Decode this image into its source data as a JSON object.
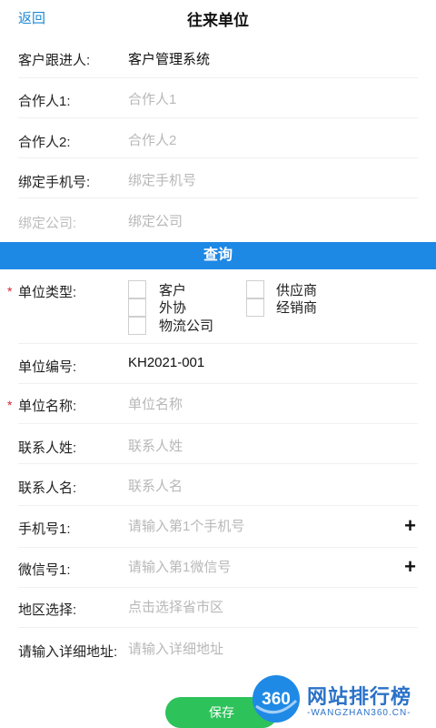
{
  "header": {
    "back_label": "返回",
    "title": "往来单位"
  },
  "top_form": {
    "follower": {
      "label": "客户跟进人:",
      "value": "客户管理系统"
    },
    "partner1": {
      "label": "合作人1:",
      "placeholder": "合作人1"
    },
    "partner2": {
      "label": "合作人2:",
      "placeholder": "合作人2"
    },
    "bind_phone": {
      "label": "绑定手机号:",
      "placeholder": "绑定手机号"
    },
    "bind_company": {
      "label": "绑定公司:",
      "placeholder": "绑定公司"
    }
  },
  "query_button": "查询",
  "unit_type": {
    "label": "单位类型:",
    "required_mark": "*",
    "options": [
      "客户",
      "供应商",
      "外协",
      "经销商",
      "物流公司"
    ]
  },
  "unit_code": {
    "label": "单位编号:",
    "value": "KH2021-001"
  },
  "unit_name": {
    "label": "单位名称:",
    "placeholder": "单位名称",
    "required_mark": "*"
  },
  "contact_surname": {
    "label": "联系人姓:",
    "placeholder": "联系人姓"
  },
  "contact_name": {
    "label": "联系人名:",
    "placeholder": "联系人名"
  },
  "phone1": {
    "label": "手机号1:",
    "placeholder": "请输入第1个手机号",
    "add_symbol": "+"
  },
  "wechat1": {
    "label": "微信号1:",
    "placeholder": "请输入第1微信号",
    "add_symbol": "+"
  },
  "region": {
    "label": "地区选择:",
    "placeholder": "点击选择省市区"
  },
  "address": {
    "label": "请输入详细地址:",
    "placeholder": "请输入详细地址"
  },
  "save_button": "保存",
  "watermark": {
    "logo_text": "360",
    "site_name": "网站排行榜",
    "site_url": "-WANGZHAN360.CN-"
  }
}
